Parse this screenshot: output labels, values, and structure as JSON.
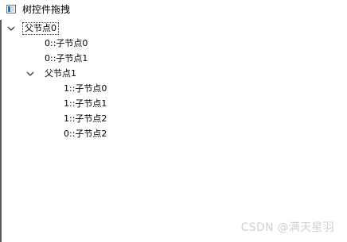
{
  "window": {
    "title": "树控件拖拽",
    "icon": "app-window-icon"
  },
  "tree": {
    "items": [
      {
        "label": "父节点0",
        "expanded": true,
        "selected": true,
        "depth": 0
      },
      {
        "label": "0::子节点0",
        "depth": 1
      },
      {
        "label": "0::子节点1",
        "depth": 1
      },
      {
        "label": "父节点1",
        "expanded": true,
        "depth": 1
      },
      {
        "label": "1::子节点0",
        "depth": 2
      },
      {
        "label": "1::子节点1",
        "depth": 2
      },
      {
        "label": "1::子节点2",
        "depth": 2
      },
      {
        "label": "0::子节点2",
        "depth": 2
      }
    ]
  },
  "watermark": "CSDN @满天星羽"
}
